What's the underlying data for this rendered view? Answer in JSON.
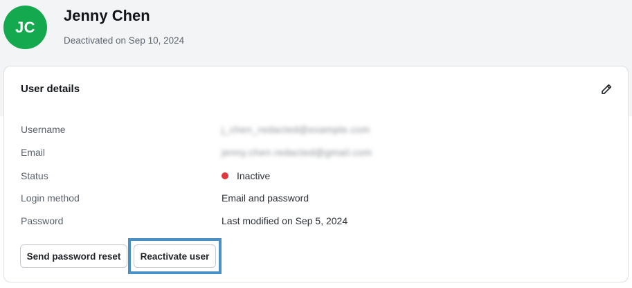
{
  "profile": {
    "initials": "JC",
    "name": "Jenny Chen",
    "subtitle": "Deactivated on Sep 10, 2024",
    "avatar_color": "#14a84f"
  },
  "card": {
    "title": "User details",
    "edit_icon": "pencil-icon"
  },
  "fields": {
    "username": {
      "label": "Username",
      "value": "j_chen_redacted@example.com"
    },
    "email": {
      "label": "Email",
      "value": "jenny.chen.redacted@gmail.com"
    },
    "status": {
      "label": "Status",
      "value": "Inactive",
      "dot_color": "#e0383e"
    },
    "login_method": {
      "label": "Login method",
      "value": "Email and password"
    },
    "password": {
      "label": "Password",
      "value": "Last modified on Sep 5, 2024"
    }
  },
  "actions": {
    "send_reset": "Send password reset",
    "reactivate": "Reactivate user"
  },
  "highlight_color": "#4a90c2"
}
